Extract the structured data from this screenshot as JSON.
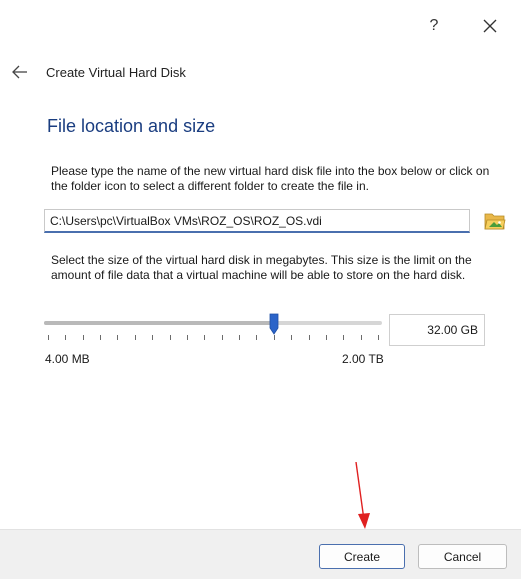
{
  "titlebar": {
    "help_label": "?",
    "close_icon": "close-icon"
  },
  "wizard": {
    "title": "Create Virtual Hard Disk",
    "back_icon": "arrow-left-icon"
  },
  "page": {
    "section_title": "File location and size",
    "location_description": "Please type the name of the new virtual hard disk file into the box below or click on the folder icon to select a different folder to create the file in.",
    "location_value": "C:\\Users\\pc\\VirtualBox VMs\\ROZ_OS\\ROZ_OS.vdi",
    "folder_icon": "folder-open-icon",
    "size_description": "Select the size of the virtual hard disk in megabytes. This size is the limit on the amount of file data that a virtual machine will be able to store on the hard disk.",
    "size_value": "32.00 GB",
    "slider_min_label": "4.00 MB",
    "slider_max_label": "2.00 TB",
    "slider_position_fraction": 0.68
  },
  "footer": {
    "create_label": "Create",
    "cancel_label": "Cancel"
  },
  "colors": {
    "section_title": "#1a3d80",
    "accent_border": "#4a6fae",
    "annotation_arrow": "#e02020",
    "footer_bg": "#f0f0f0",
    "slider_thumb": "#2b64c9"
  }
}
